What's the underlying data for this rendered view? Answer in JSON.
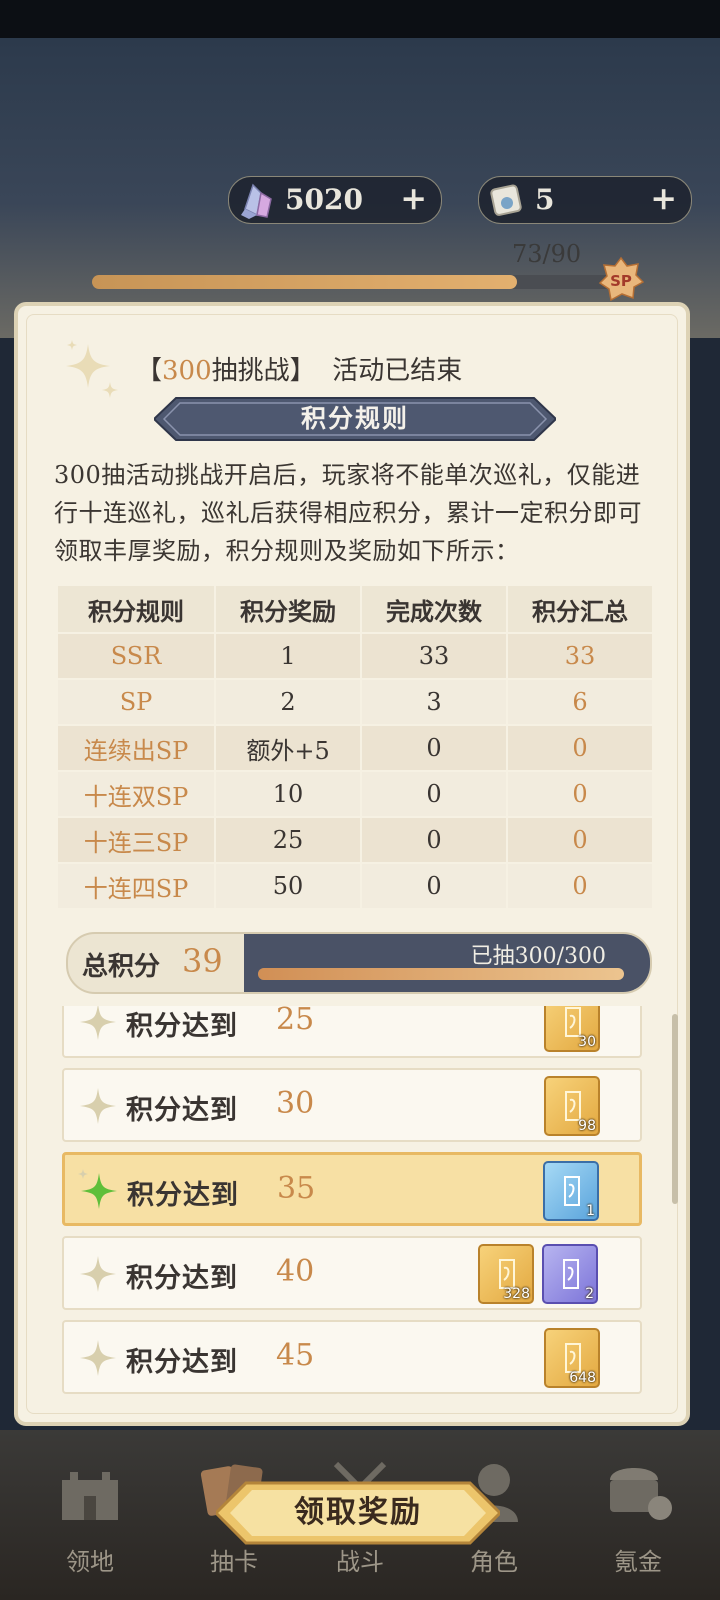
{
  "currencies": [
    {
      "icon": "crystal-icon",
      "value": "5020"
    },
    {
      "icon": "scroll-ticket-icon",
      "value": "5"
    }
  ],
  "sp_progress": {
    "text": "73/90",
    "progress": 0.811,
    "badge": "SP"
  },
  "panel": {
    "title_prefix": "【",
    "title_highlight": "300",
    "title_mid": "抽挑战】",
    "title_status": "活动已结束",
    "section_title": "积分规则",
    "intro": "300抽活动挑战开启后，玩家将不能单次巡礼，仅能进行十连巡礼，巡礼后获得相应积分，累计一定积分即可领取丰厚奖励，积分规则及奖励如下所示："
  },
  "rules_table": {
    "headers": [
      "积分规则",
      "积分奖励",
      "完成次数",
      "积分汇总"
    ],
    "rows": [
      [
        "SSR",
        "1",
        "33",
        "33"
      ],
      [
        "SP",
        "2",
        "3",
        "6"
      ],
      [
        "连续出SP",
        "额外+5",
        "0",
        "0"
      ],
      [
        "十连双SP",
        "10",
        "0",
        "0"
      ],
      [
        "十连三SP",
        "25",
        "0",
        "0"
      ],
      [
        "十连四SP",
        "50",
        "0",
        "0"
      ]
    ]
  },
  "total": {
    "label": "总积分",
    "value": "39",
    "draw_text": "已抽300/300",
    "draw_progress": 1.0
  },
  "rewards": [
    {
      "label": "积分达到",
      "value": "25",
      "active": false,
      "cards": [
        {
          "color": "gold",
          "count": "30"
        }
      ]
    },
    {
      "label": "积分达到",
      "value": "30",
      "active": false,
      "cards": [
        {
          "color": "gold",
          "count": "98"
        }
      ]
    },
    {
      "label": "积分达到",
      "value": "35",
      "active": true,
      "cards": [
        {
          "color": "blue",
          "count": "1"
        }
      ]
    },
    {
      "label": "积分达到",
      "value": "40",
      "active": false,
      "cards": [
        {
          "color": "gold",
          "count": "328"
        },
        {
          "color": "purple",
          "count": "2"
        }
      ]
    },
    {
      "label": "积分达到",
      "value": "45",
      "active": false,
      "cards": [
        {
          "color": "gold",
          "count": "648"
        }
      ]
    }
  ],
  "claim_button": "领取奖励",
  "nav": [
    {
      "icon": "castle-icon",
      "label": "领地"
    },
    {
      "icon": "cards-icon",
      "label": "抽卡"
    },
    {
      "icon": "battle-icon",
      "label": "战斗"
    },
    {
      "icon": "character-icon",
      "label": "角色"
    },
    {
      "icon": "treasure-icon",
      "label": "氪金"
    }
  ]
}
